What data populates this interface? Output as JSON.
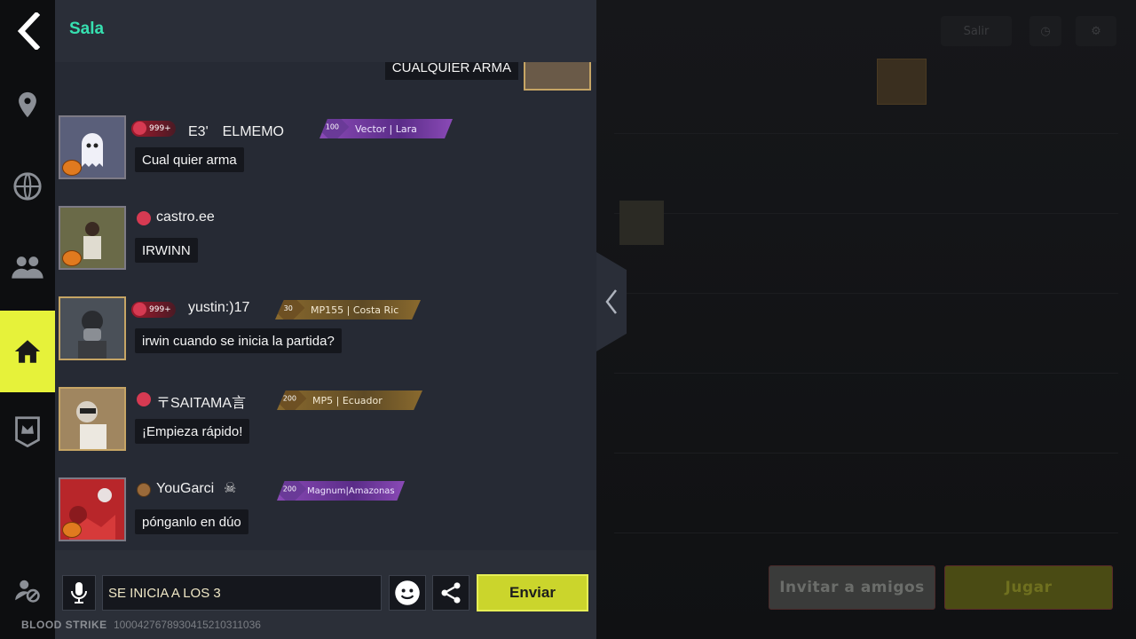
{
  "header": {
    "title": "Sala"
  },
  "top_message": {
    "text": "CUALQUIER ARMA"
  },
  "messages": [
    {
      "name": "E3'　ELMEMO",
      "level": "999+",
      "rank_num": "100",
      "rank_text": "Vector |     Lara",
      "text": "Cual quier arma"
    },
    {
      "name": "castro.ee",
      "level": "",
      "rank_num": "",
      "rank_text": "",
      "text": "IRWINN"
    },
    {
      "name": "yustin:)17",
      "level": "999+",
      "rank_num": "30",
      "rank_text": "MP155  | Costa Ric",
      "text": "irwin cuando se inicia la partida?"
    },
    {
      "name": "〒SAITAMA言",
      "level": "",
      "rank_num": "200",
      "rank_text": "MP5    | Ecuador",
      "text": "¡Empieza rápido!"
    },
    {
      "name": "YouGarci",
      "level": "",
      "rank_num": "200",
      "rank_text": "Magnum|Amazonas",
      "text": "pónganlo en dúo"
    }
  ],
  "input": {
    "value": "SE INICIA A LOS 3"
  },
  "send_label": "Enviar",
  "footer": {
    "brand": "BLOOD STRIKE",
    "id": "1000427678930415210311036"
  },
  "background": {
    "top_button": "Salir",
    "invite_label": "Invitar a amigos",
    "play_label": "Jugar"
  },
  "colors": {
    "accent_green": "#36e0b0",
    "send_yellow": "#cbd52c",
    "active_tab": "#e6f23a"
  }
}
